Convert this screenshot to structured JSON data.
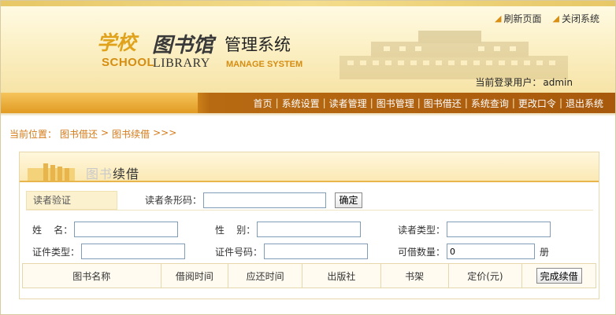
{
  "header": {
    "logo_cn": "学校",
    "logo_en": "SCHOOL",
    "library_cn": "图书馆",
    "system_cn": "管理系统",
    "library_en": "LIBRARY",
    "system_en": "MANAGE SYSTEM",
    "refresh_label": "刷新页面",
    "close_label": "关闭系统",
    "login_label": "当前登录用户：",
    "login_user": "admin"
  },
  "nav": {
    "items": [
      "首页",
      "系统设置",
      "读者管理",
      "图书管理",
      "图书借还",
      "系统查询",
      "更改口令",
      "退出系统"
    ]
  },
  "breadcrumb": {
    "prefix": "当前位置：",
    "section": "图书借还",
    "sep": ">",
    "page": "图书续借",
    "suffix": ">>>"
  },
  "panel": {
    "title_faded": "图书",
    "title_main": "续借"
  },
  "verify": {
    "label": "读者验证",
    "barcode_label": "读者条形码：",
    "barcode_value": "",
    "confirm_label": "确定"
  },
  "fields": {
    "name_label": "姓    名：",
    "gender_label": "性    别：",
    "reader_type_label": "读者类型：",
    "id_type_label": "证件类型：",
    "id_number_label": "证件号码：",
    "borrowable_label": "可借数量：",
    "borrowable_value": "0",
    "unit": "册"
  },
  "table": {
    "columns": [
      "图书名称",
      "借阅时间",
      "应还时间",
      "出版社",
      "书架",
      "定价(元)"
    ],
    "complete_label": "完成续借"
  },
  "colors": {
    "accent": "#e0981f",
    "nav_dark": "#a8590c",
    "breadcrumb": "#d57a18"
  }
}
